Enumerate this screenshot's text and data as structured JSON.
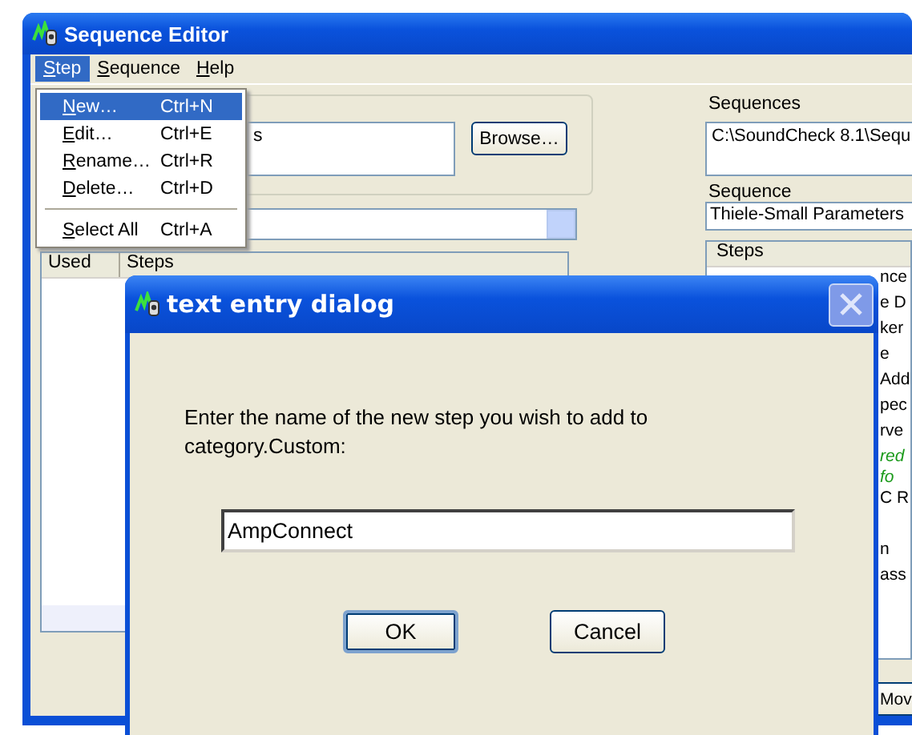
{
  "window": {
    "title": "Sequence Editor"
  },
  "menu_bar": [
    {
      "label": "Step",
      "selected": true
    },
    {
      "label": "Sequence",
      "selected": false
    },
    {
      "label": "Help",
      "selected": false
    }
  ],
  "menu": {
    "items": [
      {
        "kind": "item",
        "label": "New…",
        "shortcut": "Ctrl+N",
        "selected": true
      },
      {
        "kind": "item",
        "label": "Edit…",
        "shortcut": "Ctrl+E",
        "selected": false
      },
      {
        "kind": "item",
        "label": "Rename…",
        "shortcut": "Ctrl+R",
        "selected": false
      },
      {
        "kind": "item",
        "label": "Delete…",
        "shortcut": "Ctrl+D",
        "selected": false
      },
      {
        "kind": "separator"
      },
      {
        "kind": "item",
        "label": "Select All",
        "shortcut": "Ctrl+A",
        "selected": false
      }
    ]
  },
  "left_panel": {
    "path_field": {
      "value": "s"
    },
    "browse_button": "Browse…",
    "list_columns": [
      "Used",
      "Steps"
    ]
  },
  "right_panel": {
    "sequences_label": "Sequences",
    "sequences_field": {
      "value": "C:\\SoundCheck 8.1\\Sequ"
    },
    "sequence_label": "Sequence",
    "sequence_field": {
      "value": "Thiele-Small Parameters"
    },
    "steps_header": "Steps",
    "steps": [
      {
        "kind": "step",
        "text": "nce"
      },
      {
        "kind": "step",
        "text": "e D"
      },
      {
        "kind": "step",
        "text": "ker"
      },
      {
        "kind": "step",
        "text": "e"
      },
      {
        "kind": "step",
        "text": "Add"
      },
      {
        "kind": "step",
        "text": "pec"
      },
      {
        "kind": "step",
        "text": "rve"
      },
      {
        "kind": "comment",
        "text": "red"
      },
      {
        "kind": "comment",
        "text": "fo"
      },
      {
        "kind": "step",
        "text": "C R"
      },
      {
        "kind": "blank"
      },
      {
        "kind": "step",
        "text": "n"
      },
      {
        "kind": "step",
        "text": "ass"
      }
    ],
    "bottom_button": "Mov"
  },
  "dialog": {
    "title": "text entry dialog",
    "message": "Enter the name of the new step you wish to add to category.Custom:",
    "input": {
      "value": "AmpConnect"
    },
    "buttons": [
      {
        "label": "OK",
        "focused": true
      },
      {
        "label": "Cancel",
        "focused": false
      }
    ]
  }
}
